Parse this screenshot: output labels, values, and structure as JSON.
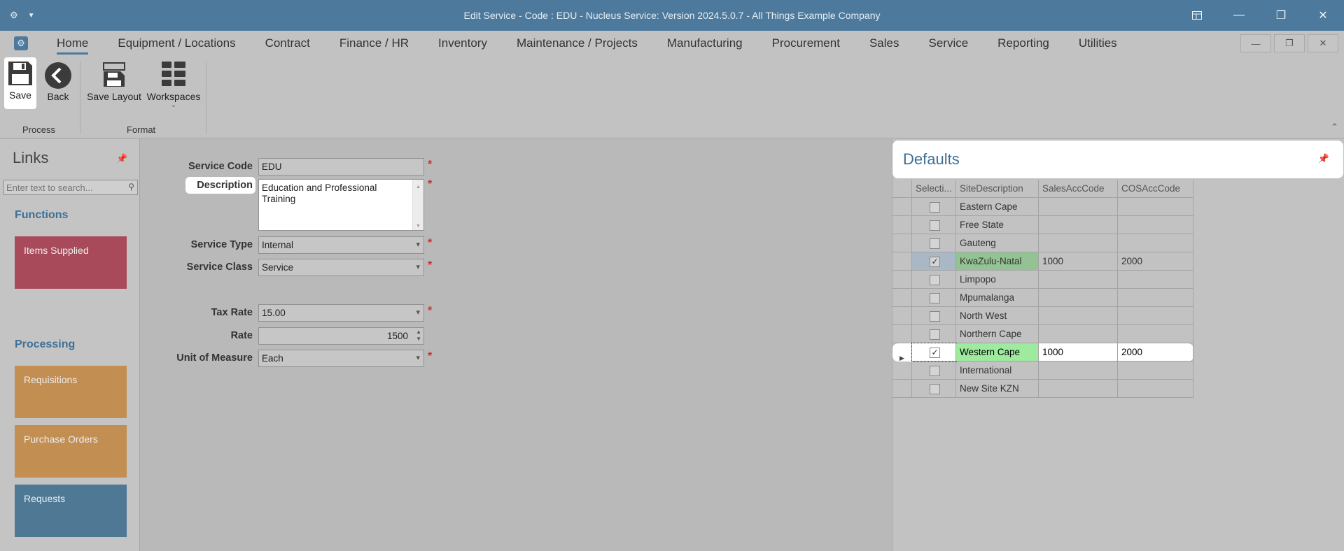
{
  "window": {
    "title": "Edit Service - Code : EDU - Nucleus Service: Version 2024.5.0.7 - All Things Example Company"
  },
  "menu": {
    "items": [
      "Home",
      "Equipment / Locations",
      "Contract",
      "Finance / HR",
      "Inventory",
      "Maintenance / Projects",
      "Manufacturing",
      "Procurement",
      "Sales",
      "Service",
      "Reporting",
      "Utilities"
    ],
    "active": "Home"
  },
  "ribbon": {
    "save_label": "Save",
    "back_label": "Back",
    "save_layout_label": "Save Layout",
    "workspaces_label": "Workspaces",
    "group_process": "Process",
    "group_format": "Format"
  },
  "links": {
    "title": "Links",
    "search_placeholder": "Enter text to search...",
    "functions_heading": "Functions",
    "items_supplied": "Items Supplied",
    "processing_heading": "Processing",
    "requisitions": "Requisitions",
    "purchase_orders": "Purchase Orders",
    "requests": "Requests"
  },
  "form": {
    "service_code_label": "Service Code",
    "service_code_value": "EDU",
    "description_label": "Description",
    "description_value": "Education and Professional Training",
    "service_type_label": "Service Type",
    "service_type_value": "Internal",
    "service_class_label": "Service Class",
    "service_class_value": "Service",
    "tax_rate_label": "Tax Rate",
    "tax_rate_value": "15.00",
    "rate_label": "Rate",
    "rate_value": "1500",
    "uom_label": "Unit of Measure",
    "uom_value": "Each",
    "required_mark": "*"
  },
  "defaults": {
    "title": "Defaults",
    "columns": [
      "Selecti...",
      "SiteDescription",
      "SalesAccCode",
      "COSAccCode"
    ],
    "rows": [
      {
        "selected": false,
        "site": "Eastern Cape",
        "sales": "",
        "cos": ""
      },
      {
        "selected": false,
        "site": "Free State",
        "sales": "",
        "cos": ""
      },
      {
        "selected": false,
        "site": "Gauteng",
        "sales": "",
        "cos": ""
      },
      {
        "selected": true,
        "site": "KwaZulu-Natal",
        "sales": "1000",
        "cos": "2000"
      },
      {
        "selected": false,
        "site": "Limpopo",
        "sales": "",
        "cos": ""
      },
      {
        "selected": false,
        "site": "Mpumalanga",
        "sales": "",
        "cos": ""
      },
      {
        "selected": false,
        "site": "North West",
        "sales": "",
        "cos": ""
      },
      {
        "selected": false,
        "site": "Northern Cape",
        "sales": "",
        "cos": ""
      },
      {
        "selected": true,
        "site": "Western Cape",
        "sales": "1000",
        "cos": "2000"
      },
      {
        "selected": false,
        "site": "International",
        "sales": "",
        "cos": ""
      },
      {
        "selected": false,
        "site": "New Site KZN",
        "sales": "",
        "cos": ""
      }
    ]
  },
  "colors": {
    "titlebar": "#4d7a9c",
    "accent": "#3e6f96",
    "required": "#d03030",
    "tile_red": "#a84a5a",
    "tile_orange": "#c28e52",
    "tile_blue": "#4e7894"
  }
}
